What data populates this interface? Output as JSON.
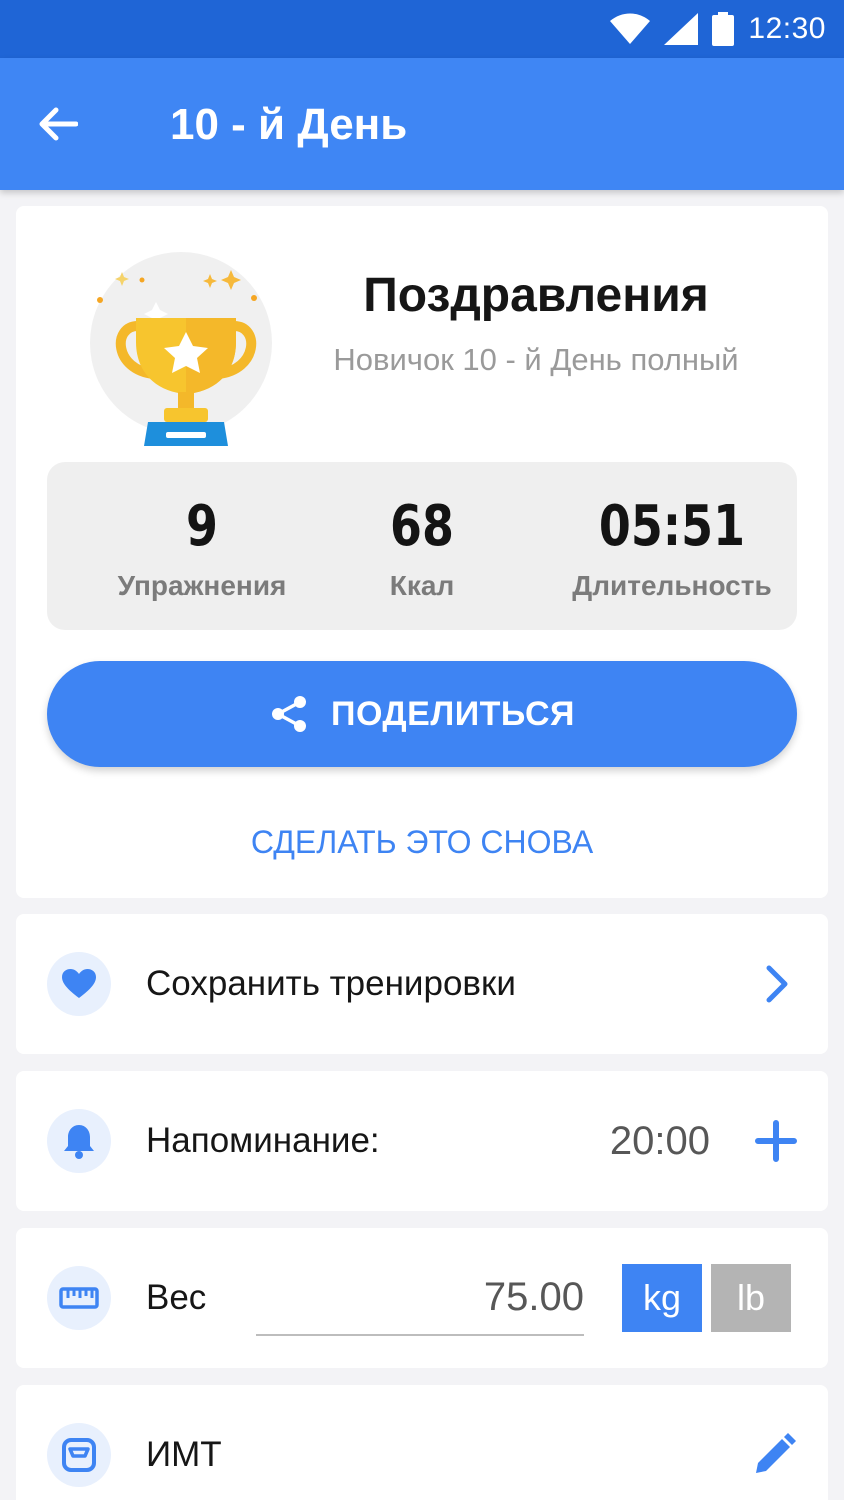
{
  "status_bar": {
    "time": "12:30"
  },
  "app_bar": {
    "title": "10 - й День"
  },
  "result": {
    "title": "Поздравления",
    "subtitle": "Новичок 10 - й День полный"
  },
  "stats": [
    {
      "value": "9",
      "label": "Упражнения"
    },
    {
      "value": "68",
      "label": "Ккал"
    },
    {
      "value": "05:51",
      "label": "Длительность"
    }
  ],
  "actions": {
    "share_label": "ПОДЕЛИТЬСЯ",
    "again_label": "СДЕЛАТЬ ЭТО СНОВА"
  },
  "save_row": {
    "label": "Сохранить тренировки"
  },
  "reminder_row": {
    "label": "Напоминание:",
    "time": "20:00"
  },
  "weight_row": {
    "label": "Вес",
    "value": "75.00",
    "unit_kg": "kg",
    "unit_lb": "lb",
    "selected_unit": "kg"
  },
  "bmi_row": {
    "label": "ИМТ"
  },
  "colors": {
    "accent": "#3e84f3",
    "status_bar": "#1f65d6",
    "app_bar": "#3f86f4",
    "trophy_gold": "#f7c52e",
    "trophy_base": "#1e8fdc"
  }
}
